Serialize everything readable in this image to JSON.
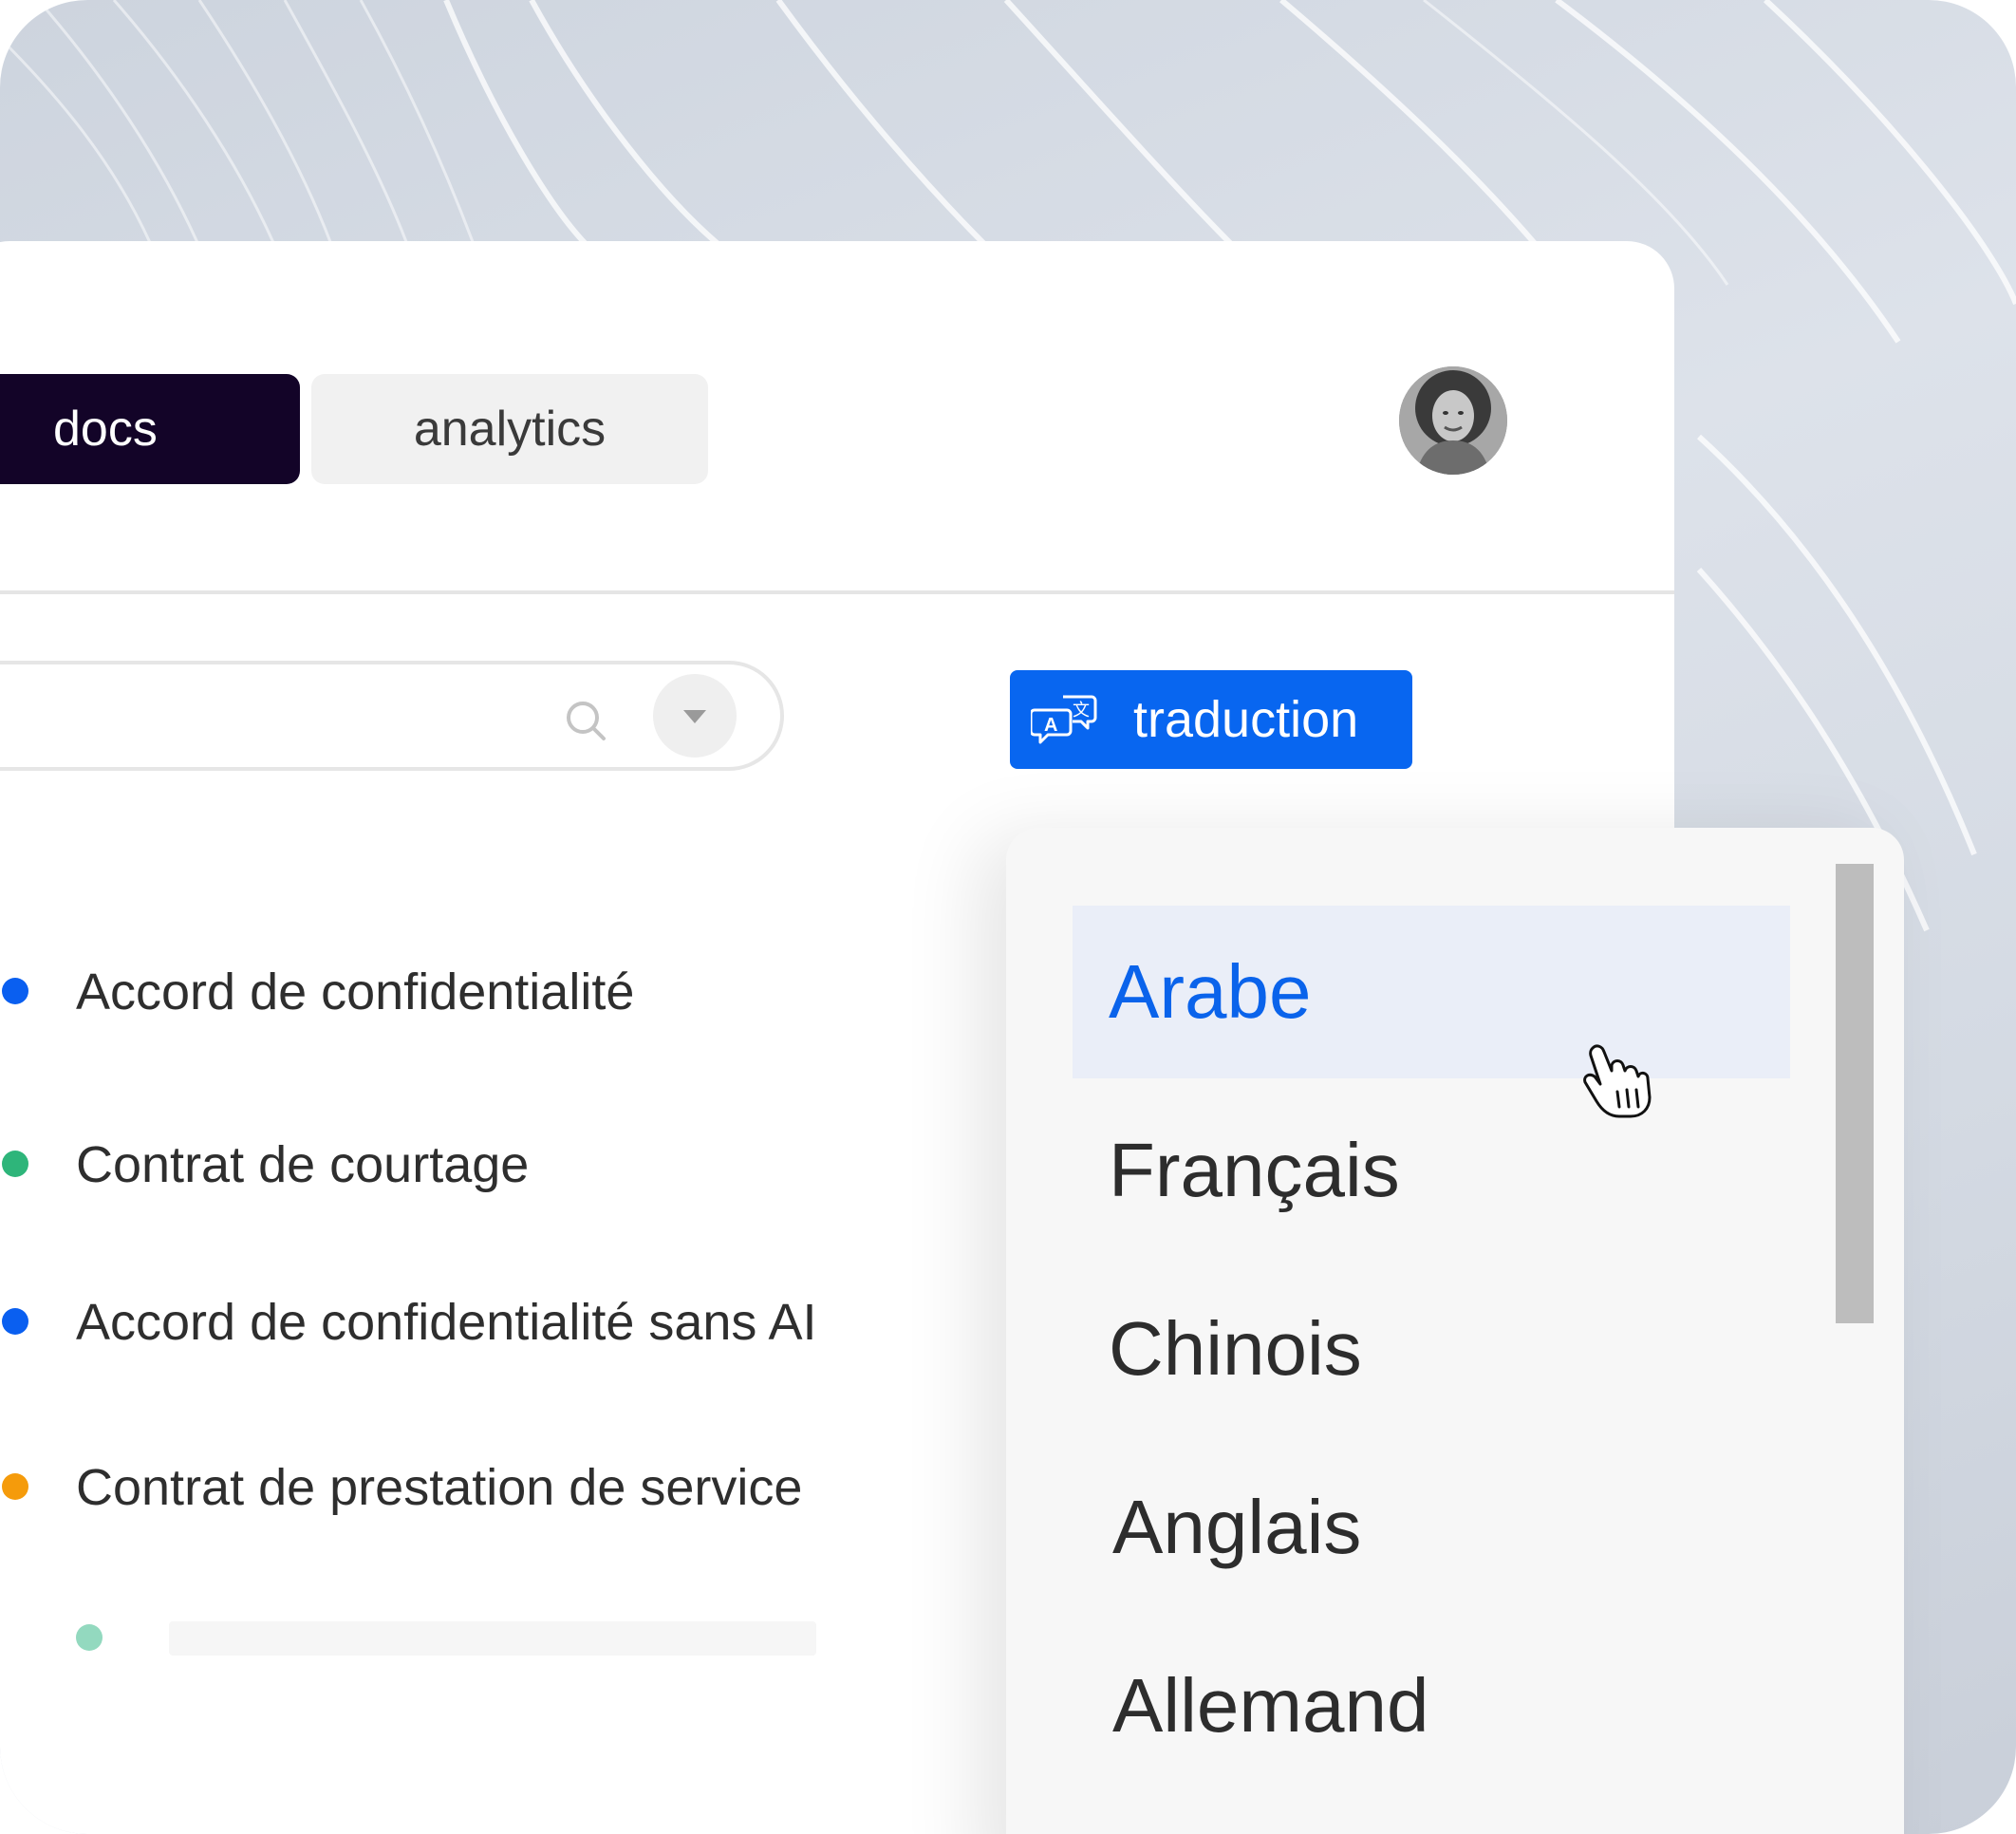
{
  "tabs": {
    "docs_label": "docs",
    "analytics_label": "analytics"
  },
  "translate_button": {
    "label": "traduction",
    "icon": "translate-icon"
  },
  "documents": [
    {
      "title": "Accord de confidentialité",
      "dot_color": "#0a5ff0"
    },
    {
      "title": "Contrat de courtage",
      "dot_color": "#2eb57a"
    },
    {
      "title": "Accord de confidentialité sans AI",
      "dot_color": "#0a5ff0"
    },
    {
      "title": "Contrat de prestation de service",
      "dot_color": "#f59b0b"
    }
  ],
  "languages": [
    {
      "label": "Arabe",
      "selected": true
    },
    {
      "label": "Français",
      "selected": false
    },
    {
      "label": "Chinois",
      "selected": false
    },
    {
      "label": "Anglais",
      "selected": false
    },
    {
      "label": "Allemand",
      "selected": false
    }
  ],
  "colors": {
    "accent": "#0866f0",
    "docs_tab_bg": "#130428",
    "selected_language": "#0a63eb",
    "placeholder_dot": "#93d9bf"
  }
}
